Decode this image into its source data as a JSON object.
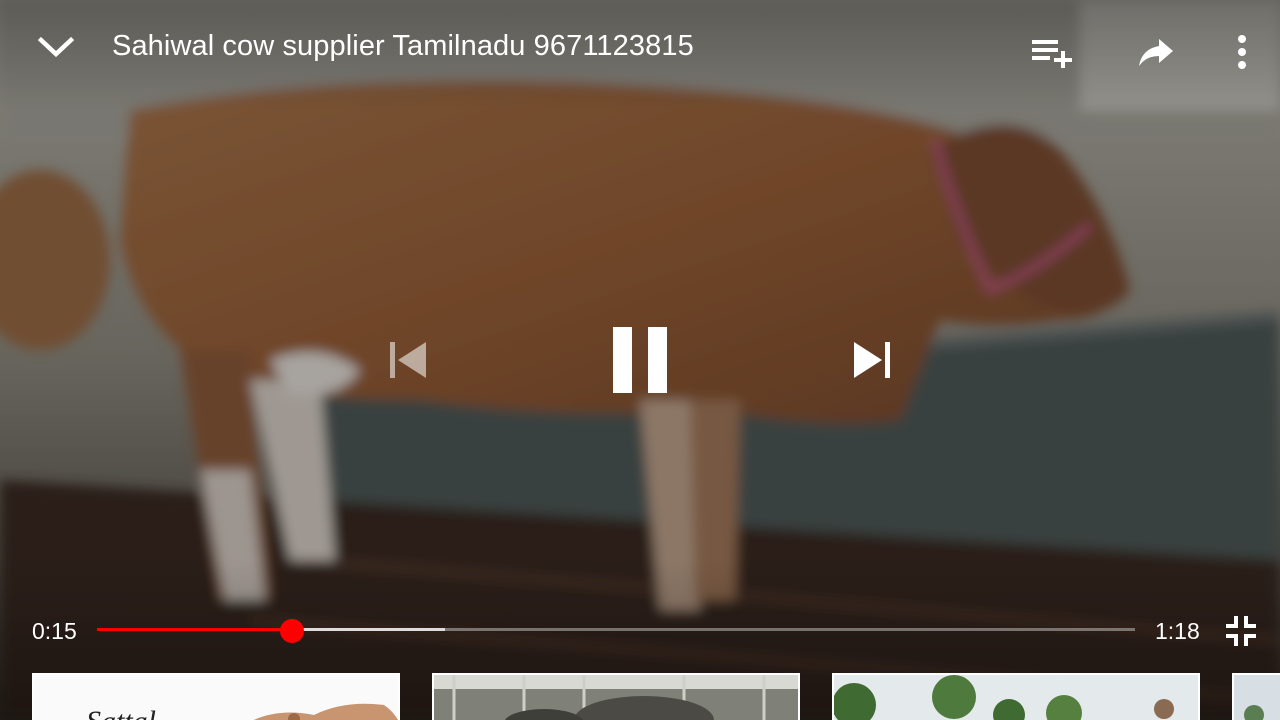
{
  "video": {
    "title": "Sahiwal cow supplier Tamilnadu 9671123815",
    "current_time": "0:15",
    "total_time": "1:18",
    "played_fraction": 0.188,
    "buffered_fraction": 0.335,
    "state": "playing"
  },
  "icons": {
    "collapse": "chevron-down-icon",
    "add_to_queue": "playlist-add-icon",
    "share": "share-icon",
    "more": "more-vert-icon",
    "previous": "skip-previous-icon",
    "pause": "pause-icon",
    "next": "skip-next-icon",
    "exit_fullscreen": "fullscreen-exit-icon"
  },
  "related": {
    "thumb1_text": "Sattal"
  },
  "colors": {
    "progress_played": "#ff0000",
    "progress_track": "#9e9e9e",
    "text": "#ffffff"
  }
}
